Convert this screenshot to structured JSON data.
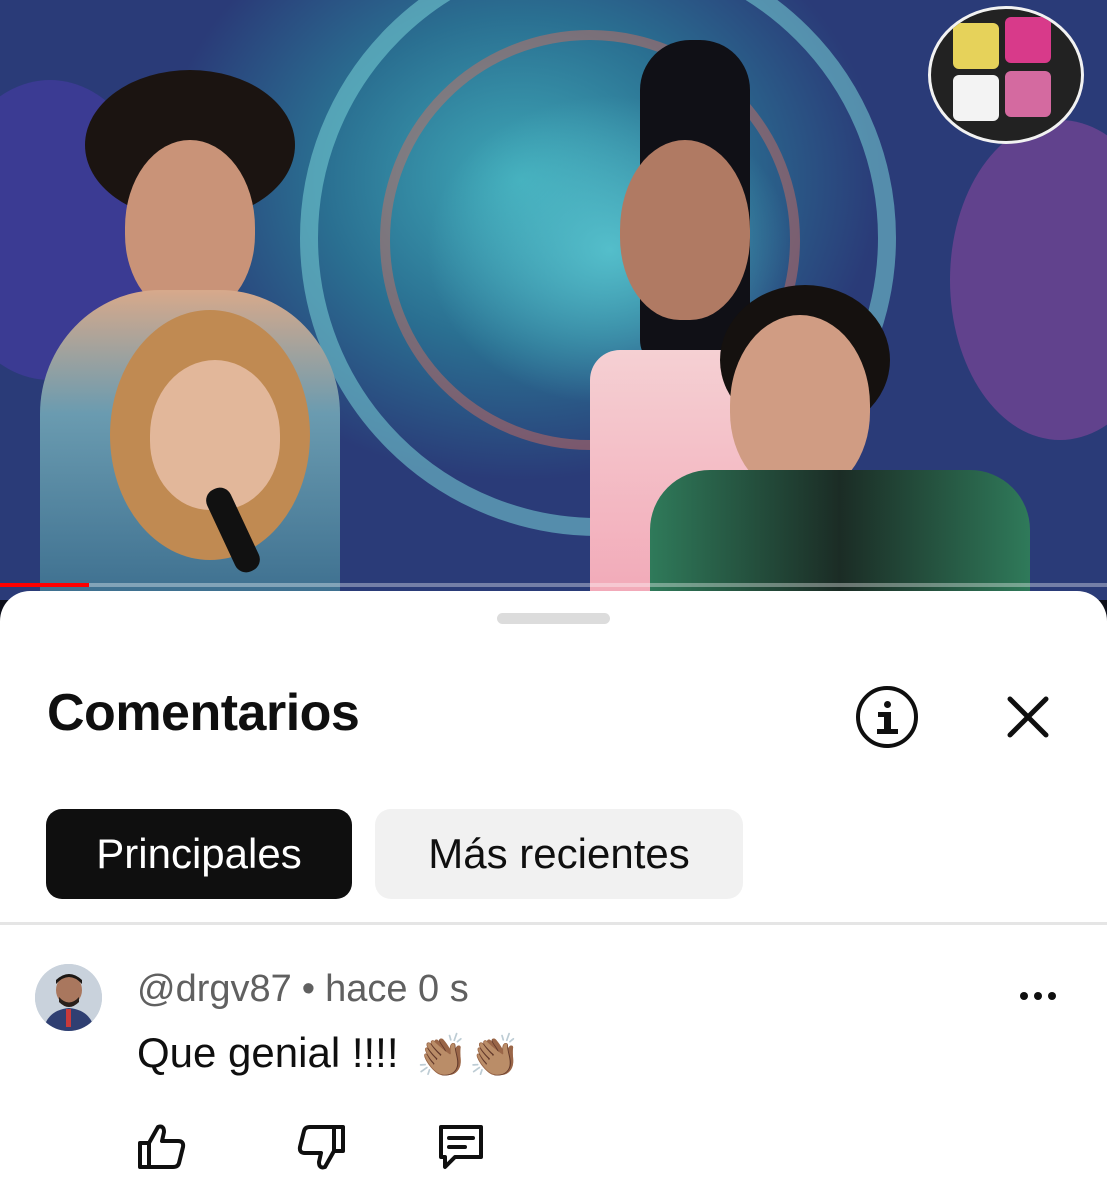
{
  "video": {
    "progress_fraction": 0.08,
    "progress_color": "#ff0000"
  },
  "comments_sheet": {
    "title": "Comentarios",
    "info_icon": "info-icon",
    "close_icon": "close-icon",
    "filters": [
      {
        "label": "Principales",
        "selected": true
      },
      {
        "label": "Más recientes",
        "selected": false
      }
    ],
    "comments": [
      {
        "username": "@drgv87",
        "separator": "•",
        "time": "hace 0 s",
        "text": "Que genial !!!!",
        "emoji": "👏🏽👏🏽",
        "actions": [
          "thumbs-up-icon",
          "thumbs-down-icon",
          "reply-icon"
        ]
      }
    ]
  },
  "colors": {
    "sheet_background": "#ffffff",
    "active_chip": "#0f0f0f",
    "inactive_chip": "#f1f1f1",
    "meta_text": "#606060"
  }
}
